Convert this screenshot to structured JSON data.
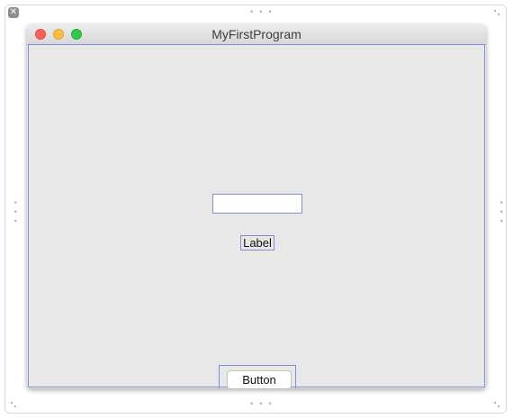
{
  "canvas": {
    "close_glyph": "✕",
    "handle_glyph": "• • •"
  },
  "window": {
    "title": "MyFirstProgram",
    "traffic_lights": {
      "close_color": "#fc605c",
      "minimize_color": "#fdbc40",
      "maximize_color": "#34c84a"
    }
  },
  "content": {
    "text_field": {
      "value": "",
      "placeholder": ""
    },
    "label": {
      "text": "Label"
    },
    "button": {
      "label": "Button"
    }
  },
  "colors": {
    "selection_outline": "#7f8fd6",
    "window_background": "#e8e8e8"
  }
}
